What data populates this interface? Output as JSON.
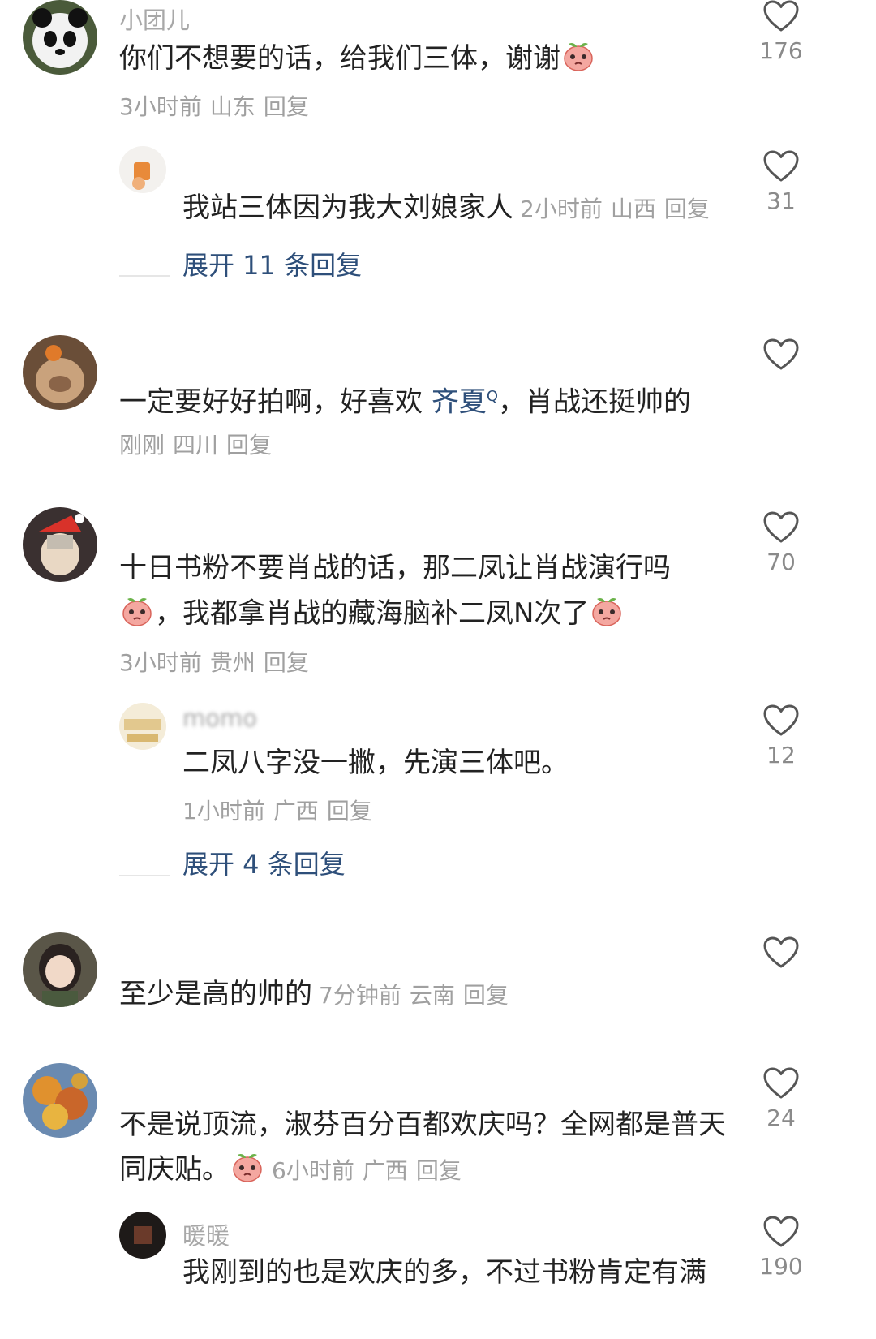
{
  "comments": [
    {
      "username": "小团儿",
      "text": "你们不想要的话，给我们三体，谢谢",
      "time": "3小时前",
      "location": "山东",
      "reply": "回复",
      "likes": "176",
      "replies": [
        {
          "username": "",
          "text": "我站三体因为我大刘娘家人",
          "time": "2小时前",
          "location": "山西",
          "reply": "回复",
          "likes": "31"
        }
      ],
      "expand_label": "展开 11 条回复"
    },
    {
      "username": "",
      "text_before_link": "一定要好好拍啊，好喜欢 ",
      "link_text": "齐夏",
      "text_after_link": "，肖战还挺帅的",
      "time": "刚刚",
      "location": "四川",
      "reply": "回复",
      "likes": ""
    },
    {
      "username": "",
      "text_line1": "十日书粉不要肖战的话，那二凤让肖战演行吗",
      "text_line2": "，我都拿肖战的藏海脑补二凤N次了",
      "time": "3小时前",
      "location": "贵州",
      "reply": "回复",
      "likes": "70",
      "replies": [
        {
          "username": "momo",
          "text": "二凤八字没一撇，先演三体吧。",
          "time": "1小时前",
          "location": "广西",
          "reply": "回复",
          "likes": "12"
        }
      ],
      "expand_label": "展开 4 条回复"
    },
    {
      "username": "",
      "text": "至少是高的帅的",
      "time": "7分钟前",
      "location": "云南",
      "reply": "回复",
      "likes": ""
    },
    {
      "username": "",
      "text_line1": "不是说顶流，淑芬百分百都欢庆吗？全网都是普天",
      "text_line2": "同庆贴。",
      "time": "6小时前",
      "location": "广西",
      "reply": "回复",
      "likes": "24",
      "replies": [
        {
          "username": "暖暖",
          "text": "我刚到的也是欢庆的多，不过书粉肯定有满",
          "likes": "190"
        }
      ]
    }
  ],
  "colors": {
    "link": "#2e4f7a",
    "meta": "#a0a0a0",
    "text": "#222222"
  },
  "icons": {
    "like": "heart-outline-icon",
    "emoji": "peach-emoji-icon"
  }
}
